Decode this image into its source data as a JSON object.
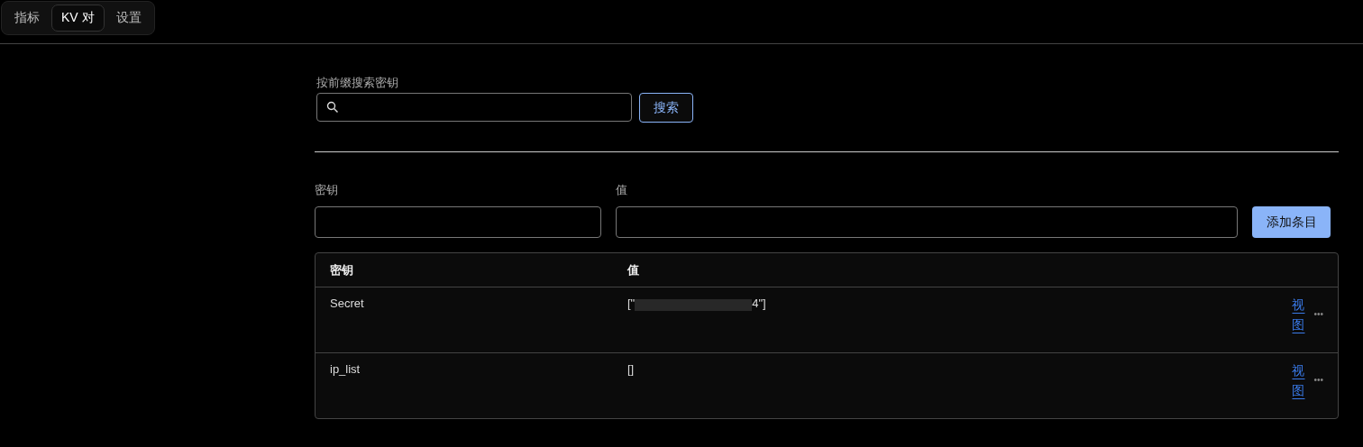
{
  "tabs": [
    {
      "label": "指标",
      "selected": false
    },
    {
      "label": "KV 对",
      "selected": true
    },
    {
      "label": "设置",
      "selected": false
    }
  ],
  "search": {
    "label": "按前缀搜索密钥",
    "button": "搜索"
  },
  "add_form": {
    "key_label": "密钥",
    "value_label": "值",
    "button": "添加条目"
  },
  "table": {
    "columns": [
      "密钥",
      "值"
    ],
    "rows": [
      {
        "key": "Secret",
        "value_prefix": "[\"",
        "redacted": true,
        "value_suffix": "4\"]",
        "action": "视图",
        "more": "•••"
      },
      {
        "key": "ip_list",
        "value_prefix": "[]",
        "redacted": false,
        "value_suffix": "",
        "action": "视图",
        "more": "•••"
      }
    ]
  }
}
